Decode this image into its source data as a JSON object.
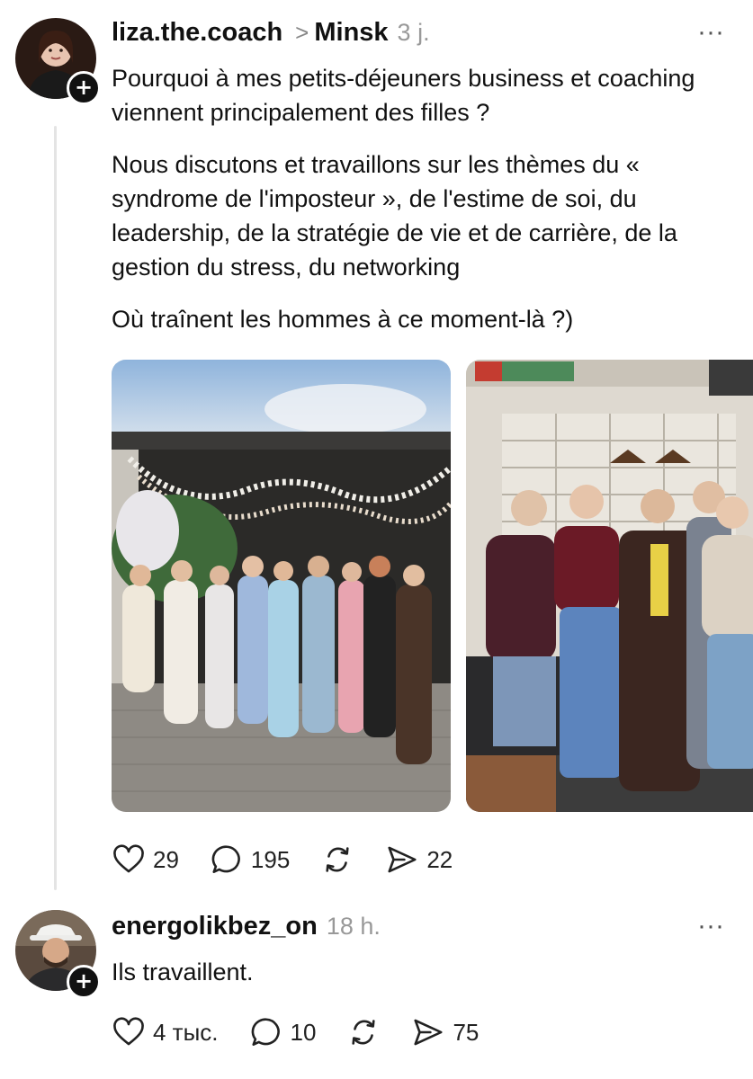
{
  "posts": [
    {
      "username": "liza.the.coach",
      "location": "Minsk",
      "time": "3 j.",
      "paragraphs": [
        "Pourquoi à mes petits-déjeuners business et coaching viennent principalement des filles ?",
        "Nous discutons et travaillons sur les thèmes du « syndrome de l'imposteur », de l'estime de soi, du leadership, de la stratégie de vie et de carrière, de la gestion du stress, du networking",
        "Où traînent les hommes à ce moment-là ?)"
      ],
      "actions": {
        "likes": "29",
        "replies": "195",
        "shares": "22"
      },
      "follow_symbol": "+",
      "more_symbol": "···"
    },
    {
      "username": "energolikbez_on",
      "time": "18 h.",
      "paragraphs": [
        "Ils travaillent."
      ],
      "actions": {
        "likes": "4 тыс.",
        "replies": "10",
        "shares": "75"
      },
      "follow_symbol": "+",
      "more_symbol": "···"
    }
  ],
  "icons": {
    "like": "heart-icon",
    "reply": "speech-bubble-icon",
    "repost": "repost-icon",
    "share": "send-icon",
    "more": "more-dots-icon",
    "follow": "plus-icon",
    "location_separator": "chevron-right-icon"
  },
  "separator_symbol": ">"
}
